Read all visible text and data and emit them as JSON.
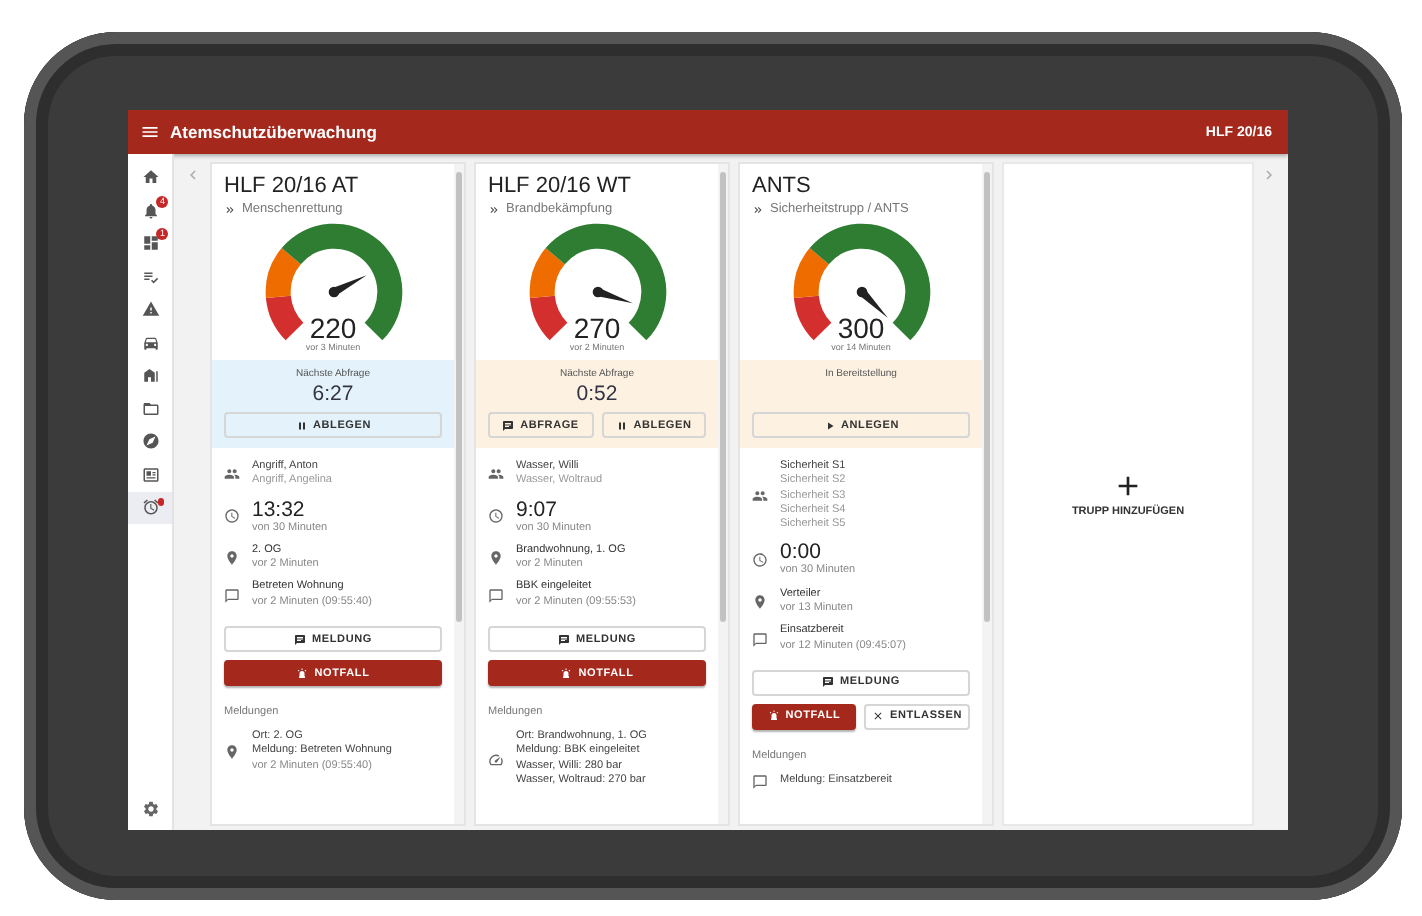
{
  "app_bar": {
    "title": "Atemschutzüberwachung",
    "unit": "HLF 20/16"
  },
  "nav": [
    {
      "selected": false
    },
    {
      "selected": false,
      "badge": "4"
    },
    {
      "selected": false,
      "badge": "1"
    },
    {
      "selected": false
    },
    {
      "selected": false
    },
    {
      "selected": false
    },
    {
      "selected": false
    },
    {
      "selected": false
    },
    {
      "selected": false
    },
    {
      "selected": false
    },
    {
      "selected": true,
      "alert": true
    }
  ],
  "cards": [
    {
      "title": "HLF 20/16 AT",
      "subtitle": "Menschenrettung",
      "gauge": {
        "value": "220",
        "age": "vor 3 Minuten"
      },
      "band": {
        "warning": false,
        "label": "Nächste Abfrage",
        "time": "6:27",
        "actions": [
          {
            "kind": "pause",
            "label": "ABLEGEN"
          }
        ]
      },
      "details": [
        {
          "kind": "crew",
          "members": [
            {
              "name": "Angriff, Anton",
              "leader": true
            },
            {
              "name": "Angriff, Angelina",
              "leader": false
            }
          ]
        },
        {
          "kind": "time",
          "value": "13:32",
          "sub": "von 30 Minuten"
        },
        {
          "kind": "location",
          "value": "2. OG",
          "sub": "vor 2 Minuten"
        },
        {
          "kind": "message",
          "value": "Betreten Wohnung",
          "sub": "vor 2 Minuten (09:55:40)"
        }
      ],
      "buttons": [
        [
          {
            "kind": "message",
            "label": "MELDUNG"
          }
        ],
        [
          {
            "kind": "alarm",
            "label": "NOTFALL"
          }
        ]
      ],
      "log": {
        "heading": "Meldungen",
        "entries": [
          {
            "kind": "location",
            "lines": [
              "Ort: 2. OG",
              "Meldung: Betreten Wohnung"
            ],
            "sub": "vor 2 Minuten (09:55:40)"
          }
        ]
      }
    },
    {
      "title": "HLF 20/16 WT",
      "subtitle": "Brandbekämpfung",
      "gauge": {
        "value": "270",
        "age": "vor 2 Minuten"
      },
      "band": {
        "warning": true,
        "label": "Nächste Abfrage",
        "time": "0:52",
        "actions": [
          {
            "kind": "message",
            "label": "ABFRAGE"
          },
          {
            "kind": "pause",
            "label": "ABLEGEN"
          }
        ]
      },
      "details": [
        {
          "kind": "crew",
          "members": [
            {
              "name": "Wasser, Willi",
              "leader": true
            },
            {
              "name": "Wasser, Woltraud",
              "leader": false
            }
          ]
        },
        {
          "kind": "time",
          "value": "9:07",
          "sub": "von 30 Minuten"
        },
        {
          "kind": "location",
          "value": "Brandwohnung, 1. OG",
          "sub": "vor 2 Minuten"
        },
        {
          "kind": "message",
          "value": "BBK eingeleitet",
          "sub": "vor 2 Minuten (09:55:53)"
        }
      ],
      "buttons": [
        [
          {
            "kind": "message",
            "label": "MELDUNG"
          }
        ],
        [
          {
            "kind": "alarm",
            "label": "NOTFALL"
          }
        ]
      ],
      "log": {
        "heading": "Meldungen",
        "entries": [
          {
            "kind": "gauge",
            "lines": [
              "Ort: Brandwohnung, 1. OG",
              "Meldung: BBK eingeleitet",
              "Wasser, Willi: 280 bar",
              "Wasser, Woltraud: 270 bar"
            ]
          }
        ]
      }
    },
    {
      "title": "ANTS",
      "subtitle": "Sicherheitstrupp / ANTS",
      "gauge": {
        "value": "300",
        "age": "vor 14 Minuten"
      },
      "band": {
        "warning": true,
        "label": "In Bereitstellung",
        "actions": [
          {
            "kind": "play",
            "label": "ANLEGEN"
          }
        ]
      },
      "details": [
        {
          "kind": "crew",
          "members": [
            {
              "name": "Sicherheit S1",
              "leader": true
            },
            {
              "name": "Sicherheit S2",
              "leader": false
            },
            {
              "name": "Sicherheit S3",
              "leader": false
            },
            {
              "name": "Sicherheit S4",
              "leader": false
            },
            {
              "name": "Sicherheit S5",
              "leader": false
            }
          ]
        },
        {
          "kind": "time",
          "value": "0:00",
          "sub": "von 30 Minuten"
        },
        {
          "kind": "location",
          "value": "Verteiler",
          "sub": "vor 13 Minuten"
        },
        {
          "kind": "message",
          "value": "Einsatzbereit",
          "sub": "vor 12 Minuten (09:45:07)"
        }
      ],
      "buttons": [
        [
          {
            "kind": "message",
            "label": "MELDUNG"
          }
        ],
        [
          {
            "kind": "alarm",
            "label": "NOTFALL"
          },
          {
            "kind": "close",
            "label": "ENTLASSEN"
          }
        ]
      ],
      "log": {
        "heading": "Meldungen",
        "entries": [
          {
            "kind": "message",
            "lines": [
              "Meldung: Einsatzbereit"
            ]
          }
        ]
      }
    }
  ],
  "add_panel": {
    "label": "TRUPP HINZUFÜGEN"
  }
}
